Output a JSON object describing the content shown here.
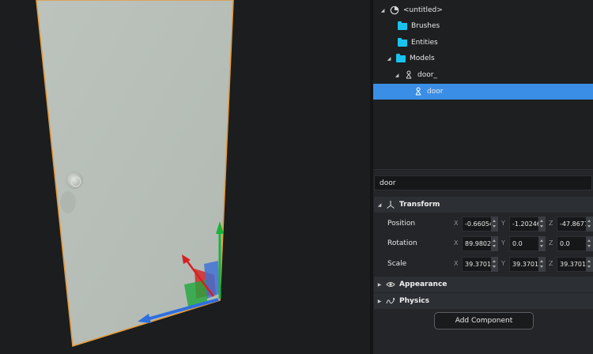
{
  "scene_tree": {
    "items": [
      {
        "label": "<untitled>",
        "icon": "scene-icon",
        "expanded": true
      },
      {
        "label": "Brushes",
        "icon": "folder-icon"
      },
      {
        "label": "Entities",
        "icon": "folder-icon"
      },
      {
        "label": "Models",
        "icon": "folder-icon",
        "expanded": true
      },
      {
        "label": "door_",
        "icon": "model-icon",
        "expanded": true
      },
      {
        "label": "door",
        "icon": "model-icon",
        "selected": true
      }
    ]
  },
  "inspector": {
    "name_value": "door",
    "transform": {
      "title": "Transform",
      "position": {
        "label": "Position",
        "x": "-0.66054",
        "y": "-1.20246",
        "z": "-47.8677"
      },
      "rotation": {
        "label": "Rotation",
        "x": "89.9802",
        "y": "0.0",
        "z": "0.0"
      },
      "scale": {
        "label": "Scale",
        "x": "39.3701",
        "y": "39.3701",
        "z": "39.3701"
      },
      "axis_labels": {
        "x": "X",
        "y": "Y",
        "z": "Z"
      }
    },
    "appearance": {
      "title": "Appearance"
    },
    "physics": {
      "title": "Physics"
    },
    "add_component_label": "Add Component"
  },
  "colors": {
    "selection": "#3a8ee6",
    "folder": "#19c3ee",
    "gizmo_x": "#d61f1f",
    "gizmo_y": "#18b33a",
    "gizmo_z": "#2f6fe0",
    "door_outline": "#e39a3c"
  }
}
